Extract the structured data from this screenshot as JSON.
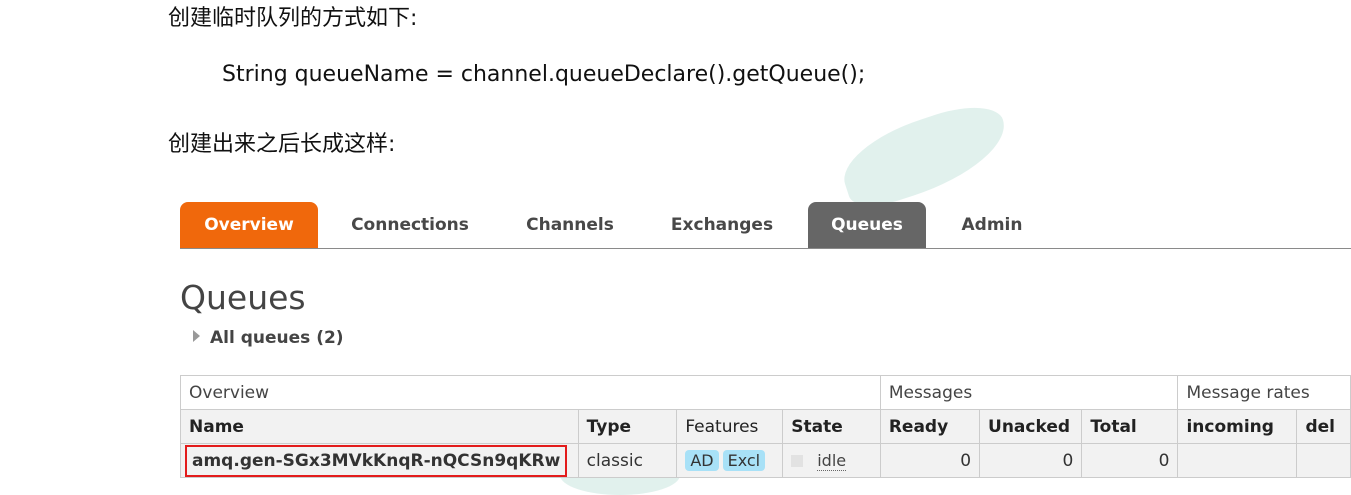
{
  "doc": {
    "intro1": "创建临时队列的方式如下:",
    "code": "String queueName = channel.queueDeclare().getQueue();",
    "intro2": "创建出来之后长成这样:"
  },
  "nav": {
    "tabs": [
      {
        "label": "Overview"
      },
      {
        "label": "Connections"
      },
      {
        "label": "Channels"
      },
      {
        "label": "Exchanges"
      },
      {
        "label": "Queues"
      },
      {
        "label": "Admin"
      }
    ]
  },
  "main": {
    "title": "Queues",
    "all_queues": "All queues (2)"
  },
  "table": {
    "groups": [
      "Overview",
      "Messages",
      "Message rates"
    ],
    "headers": {
      "name": "Name",
      "type": "Type",
      "features": "Features",
      "state": "State",
      "ready": "Ready",
      "unacked": "Unacked",
      "total": "Total",
      "incoming": "incoming",
      "deliver": "del"
    },
    "row": {
      "name": "amq.gen-SGx3MVkKnqR-nQCSn9qKRw",
      "type": "classic",
      "feature_ad": "AD",
      "feature_excl": "Excl",
      "state": "idle",
      "ready": "0",
      "unacked": "0",
      "total": "0"
    }
  },
  "colors": {
    "overview_tab": "#f0680c",
    "queues_tab": "#666666",
    "feature_badge": "#a8e1f7",
    "highlight_border": "#e31b1b"
  }
}
